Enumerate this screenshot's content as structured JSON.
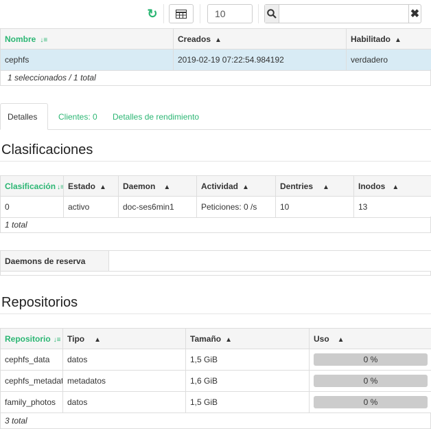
{
  "toolbar": {
    "limit_value": "10",
    "search_placeholder": ""
  },
  "fs_table": {
    "headers": [
      "Nombre",
      "Creados",
      "Habilitado"
    ],
    "rows": [
      {
        "name": "cephfs",
        "created": "2019-02-19 07:22:54.984192",
        "enabled": "verdadero"
      }
    ],
    "footer": "1 seleccionados / 1 total"
  },
  "tabs": [
    "Detalles",
    "Clientes: 0",
    "Detalles de rendimiento"
  ],
  "ranks": {
    "title": "Clasificaciones",
    "headers": [
      "Clasificación",
      "Estado",
      "Daemon",
      "Actividad",
      "Dentries",
      "Inodos"
    ],
    "rows": [
      {
        "rank": "0",
        "state": "activo",
        "daemon": "doc-ses6min1",
        "activity": "Peticiones: 0 /s",
        "dentries": "10",
        "inodes": "13"
      }
    ],
    "footer": "1 total"
  },
  "standby": {
    "label": "Daemons de reserva",
    "value": ""
  },
  "pools": {
    "title": "Repositorios",
    "headers": [
      "Repositorio",
      "Tipo",
      "Tamaño",
      "Uso"
    ],
    "rows": [
      {
        "pool": "cephfs_data",
        "type": "datos",
        "size": "1,5 GiB",
        "usage": "0 %"
      },
      {
        "pool": "cephfs_metadata",
        "type": "metadatos",
        "size": "1,6 GiB",
        "usage": "0 %"
      },
      {
        "pool": "family_photos",
        "type": "datos",
        "size": "1,5 GiB",
        "usage": "0 %"
      }
    ],
    "footer": "3 total"
  },
  "colors": {
    "accent": "#2bb673",
    "selected_row": "#d8ebf5"
  }
}
